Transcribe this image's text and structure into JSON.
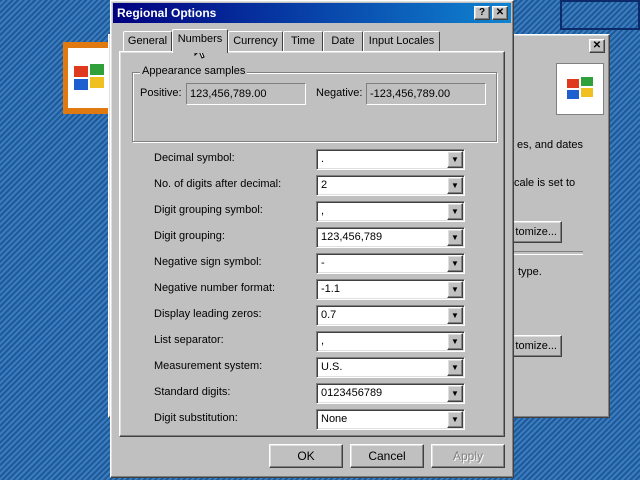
{
  "dialog": {
    "title": "Regional Options",
    "tabs": [
      "General",
      "Numbers",
      "Currency",
      "Time",
      "Date",
      "Input Locales"
    ],
    "active_tab": "Numbers",
    "appearance": {
      "group_title": "Appearance samples",
      "positive_label": "Positive:",
      "positive_value": "123,456,789.00",
      "negative_label": "Negative:",
      "negative_value": "-123,456,789.00"
    },
    "settings": [
      {
        "label": "Decimal symbol:",
        "value": "."
      },
      {
        "label": "No. of digits after decimal:",
        "value": "2"
      },
      {
        "label": "Digit grouping symbol:",
        "value": ","
      },
      {
        "label": "Digit grouping:",
        "value": "123,456,789"
      },
      {
        "label": "Negative sign symbol:",
        "value": "-"
      },
      {
        "label": "Negative number format:",
        "value": "-1.1"
      },
      {
        "label": "Display leading zeros:",
        "value": "0.7"
      },
      {
        "label": "List separator:",
        "value": ","
      },
      {
        "label": "Measurement system:",
        "value": "U.S."
      },
      {
        "label": "Standard digits:",
        "value": "0123456789"
      },
      {
        "label": "Digit substitution:",
        "value": "None"
      }
    ],
    "buttons": {
      "ok": "OK",
      "cancel": "Cancel",
      "apply": "Apply"
    },
    "help_glyph": "?",
    "close_glyph": "✕"
  },
  "background_window": {
    "text_1": "es, and dates",
    "text_2": "cale is set to",
    "button_1": "tomize...",
    "text_3": "type.",
    "button_2": "tomize...",
    "close_glyph": "✕"
  },
  "colors": {
    "desktop": "#2a6aa8",
    "titlebar_start": "#000080",
    "titlebar_end": "#1084d0",
    "face": "#c0c0c0"
  }
}
